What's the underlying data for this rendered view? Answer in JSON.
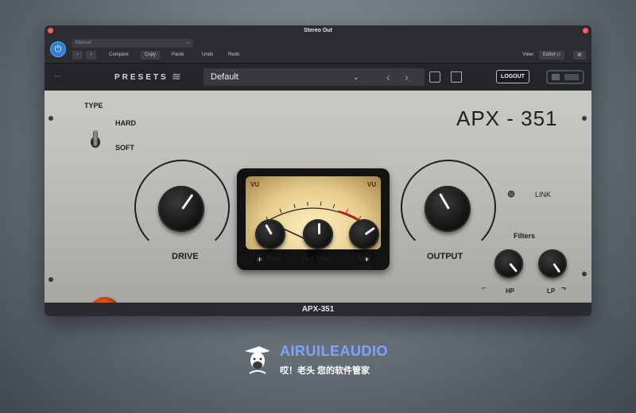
{
  "window": {
    "title": "Stereo Out"
  },
  "host": {
    "preset_select_value": "Manual",
    "buttons": {
      "compare": "Compare",
      "copy": "Copy",
      "paste": "Paste",
      "undo": "Undo",
      "redo": "Redo"
    },
    "view_label": "View:",
    "view_value": "Editor"
  },
  "plugin": {
    "presets_label": "PRESETS",
    "current_preset": "Default",
    "logout_label": "LOGOUT",
    "model": "APX - 351",
    "type_label": "TYPE",
    "type_options": [
      "HARD",
      "SOFT"
    ],
    "controls": {
      "drive": "DRIVE",
      "in_trim": "In Trim",
      "out_trim": "Out Trim",
      "mix": "Mix",
      "mix_sub": "(DRY)",
      "output": "OUTPUT",
      "link": "LINK",
      "filters": "Filters",
      "hp": "HP",
      "lp": "LP"
    },
    "meter": {
      "vu_left": "VU",
      "vu_right": "VU"
    },
    "footer_title": "APX-351"
  },
  "watermark": {
    "name": "AIRUILEAUDIO",
    "slogan": "哎！老头 您的软件管家"
  },
  "colors": {
    "accent": "#2f7fd6",
    "brand": "#7ea3ff",
    "lamp": "#e0531e"
  }
}
